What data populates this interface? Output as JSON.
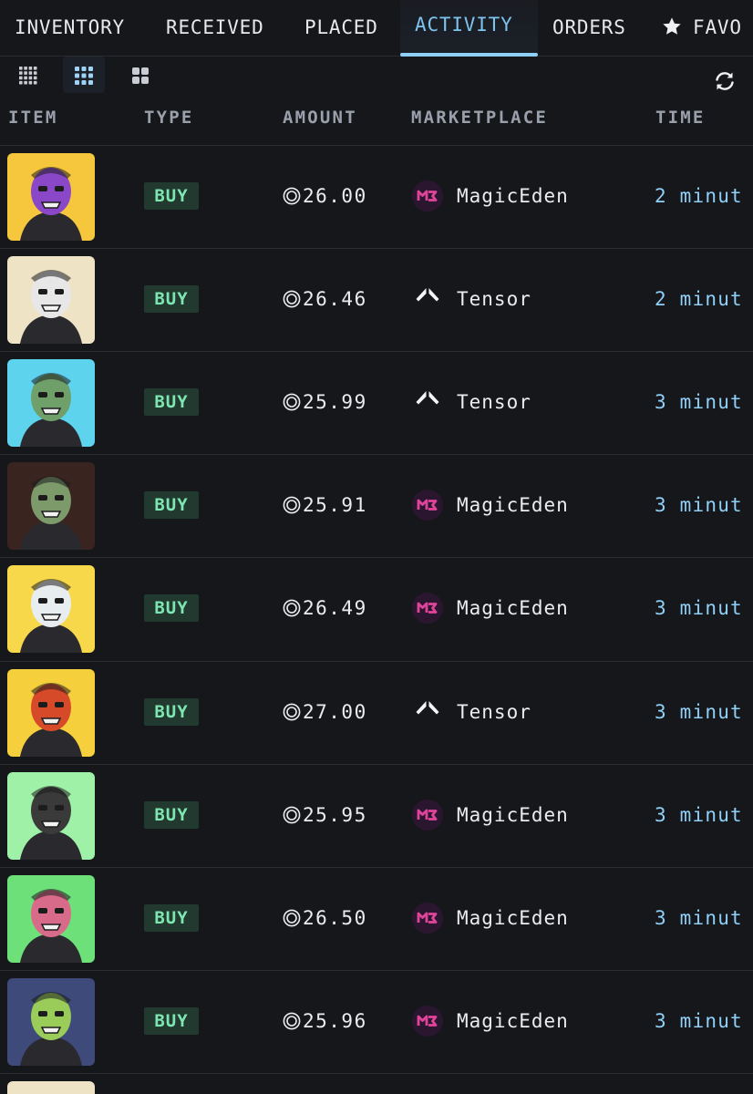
{
  "tabs": [
    {
      "label": "INVENTORY",
      "active": false
    },
    {
      "label": "RECEIVED",
      "active": false
    },
    {
      "label": "PLACED",
      "active": false
    },
    {
      "label": "ACTIVITY",
      "active": true
    },
    {
      "label": "ORDERS",
      "active": false
    },
    {
      "label": "FAVO",
      "active": false,
      "icon": "star-icon"
    }
  ],
  "view_toggles": [
    {
      "icon": "grid-small-icon",
      "active": false
    },
    {
      "icon": "grid-medium-icon",
      "active": true
    },
    {
      "icon": "grid-large-icon",
      "active": false
    }
  ],
  "refresh_icon": "refresh-icon",
  "table": {
    "headers": [
      "ITEM",
      "TYPE",
      "AMOUNT",
      "MARKETPLACE",
      "TIME"
    ],
    "currency_icon": "coin-icon",
    "rows": [
      {
        "type": "BUY",
        "amount": "26.00",
        "marketplace": "MagicEden",
        "marketplace_icon": "magiceden-icon",
        "time": "2 minut",
        "thumb_bg": "#f6c63c",
        "thumb_accent": "#8a48c8"
      },
      {
        "type": "BUY",
        "amount": "26.46",
        "marketplace": "Tensor",
        "marketplace_icon": "tensor-icon",
        "time": "2 minut",
        "thumb_bg": "#efe3c6",
        "thumb_accent": "#e7e7e7"
      },
      {
        "type": "BUY",
        "amount": "25.99",
        "marketplace": "Tensor",
        "marketplace_icon": "tensor-icon",
        "time": "3 minut",
        "thumb_bg": "#5ed3ee",
        "thumb_accent": "#6fa06a"
      },
      {
        "type": "BUY",
        "amount": "25.91",
        "marketplace": "MagicEden",
        "marketplace_icon": "magiceden-icon",
        "time": "3 minut",
        "thumb_bg": "#3a2420",
        "thumb_accent": "#7c9a6a"
      },
      {
        "type": "BUY",
        "amount": "26.49",
        "marketplace": "MagicEden",
        "marketplace_icon": "magiceden-icon",
        "time": "3 minut",
        "thumb_bg": "#f6d84a",
        "thumb_accent": "#e8eef0"
      },
      {
        "type": "BUY",
        "amount": "27.00",
        "marketplace": "Tensor",
        "marketplace_icon": "tensor-icon",
        "time": "3 minut",
        "thumb_bg": "#f6cf3c",
        "thumb_accent": "#d64a2a"
      },
      {
        "type": "BUY",
        "amount": "25.95",
        "marketplace": "MagicEden",
        "marketplace_icon": "magiceden-icon",
        "time": "3 minut",
        "thumb_bg": "#9ff1a8",
        "thumb_accent": "#3a3a3a"
      },
      {
        "type": "BUY",
        "amount": "26.50",
        "marketplace": "MagicEden",
        "marketplace_icon": "magiceden-icon",
        "time": "3 minut",
        "thumb_bg": "#6de07a",
        "thumb_accent": "#d86a8a"
      },
      {
        "type": "BUY",
        "amount": "25.96",
        "marketplace": "MagicEden",
        "marketplace_icon": "magiceden-icon",
        "time": "3 minut",
        "thumb_bg": "#3d4a7a",
        "thumb_accent": "#9acc5a"
      }
    ]
  },
  "colors": {
    "background": "#16171b",
    "accent": "#8fd0f8",
    "buy_badge_bg": "#21392f",
    "buy_badge_text": "#7ee6b0",
    "magiceden": "#e0449a"
  }
}
